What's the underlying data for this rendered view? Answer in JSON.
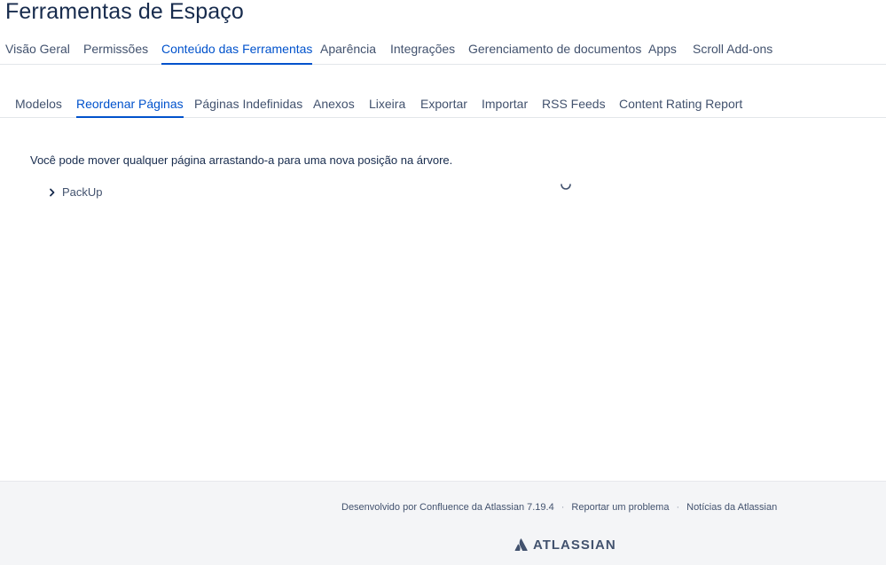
{
  "page": {
    "title": "Ferramentas de Espaço"
  },
  "top_tabs": [
    {
      "label": "Visão Geral"
    },
    {
      "label": "Permissões"
    },
    {
      "label": "Conteúdo das Ferramentas",
      "active": true
    },
    {
      "label": "Aparência"
    },
    {
      "label": "Integrações"
    },
    {
      "label": "Gerenciamento de documentos"
    },
    {
      "label": "Apps"
    },
    {
      "label": "Scroll Add-ons"
    }
  ],
  "sub_tabs": [
    {
      "label": "Modelos"
    },
    {
      "label": "Reordenar Páginas",
      "active": true
    },
    {
      "label": "Páginas Indefinidas"
    },
    {
      "label": "Anexos"
    },
    {
      "label": "Lixeira"
    },
    {
      "label": "Exportar"
    },
    {
      "label": "Importar"
    },
    {
      "label": "RSS Feeds"
    },
    {
      "label": "Content Rating Report"
    }
  ],
  "main": {
    "instruction": "Você pode mover qualquer página arrastando-a para uma nova posição na árvore.",
    "tree": [
      {
        "label": "PackUp",
        "icon": "chevron-right-icon"
      }
    ],
    "loading_icon": "spinner-icon"
  },
  "footer": {
    "powered_by": "Desenvolvido por Confluence da Atlassian 7.19.4",
    "separator": "·",
    "report_problem": "Reportar um problema",
    "news": "Notícias da Atlassian",
    "brand": "ATLASSIAN",
    "brand_icon": "atlassian-logo-icon"
  },
  "colors": {
    "accent": "#0052cc",
    "text": "#172b4d",
    "muted": "#42526e",
    "footer_bg": "#f4f5f7"
  }
}
